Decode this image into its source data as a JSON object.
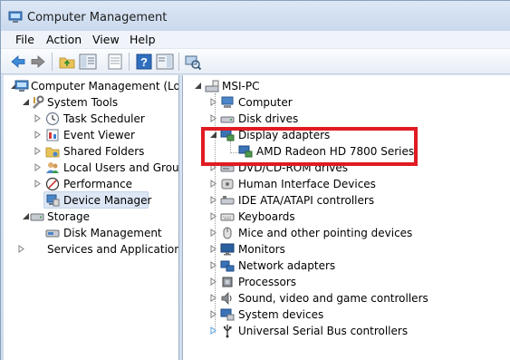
{
  "window": {
    "title": "Computer Management"
  },
  "menu": [
    "File",
    "Action",
    "View",
    "Help"
  ],
  "toolbar": {
    "buttons": [
      "back-arrow-icon",
      "forward-arrow-icon",
      "up-folder-icon",
      "console-tree-icon",
      "export-list-icon",
      "help-icon",
      "show-hide-pane-icon",
      "scan-hardware-icon"
    ]
  },
  "left_tree": {
    "root": "Computer Management (Local",
    "system_tools": "System Tools",
    "task_scheduler": "Task Scheduler",
    "event_viewer": "Event Viewer",
    "shared_folders": "Shared Folders",
    "local_users": "Local Users and Groups",
    "performance": "Performance",
    "device_manager": "Device Manager",
    "storage": "Storage",
    "disk_management": "Disk Management",
    "services": "Services and Applications"
  },
  "device_tree": {
    "root": "MSI-PC",
    "computer": "Computer",
    "disk_drives": "Disk drives",
    "display_adapters": "Display adapters",
    "amd_radeon": "AMD Radeon HD 7800 Series",
    "dvd": "DVD/CD-ROM drives",
    "hid": "Human Interface Devices",
    "ide": "IDE ATA/ATAPI controllers",
    "keyboards": "Keyboards",
    "mice": "Mice and other pointing devices",
    "monitors": "Monitors",
    "network": "Network adapters",
    "processors": "Processors",
    "sound": "Sound, video and game controllers",
    "system_devices": "System devices",
    "usb": "Universal Serial Bus controllers"
  },
  "colors": {
    "highlight_box": "#e01b22",
    "selection": "#dde6f4",
    "window_chrome": "#dbe6f4"
  }
}
